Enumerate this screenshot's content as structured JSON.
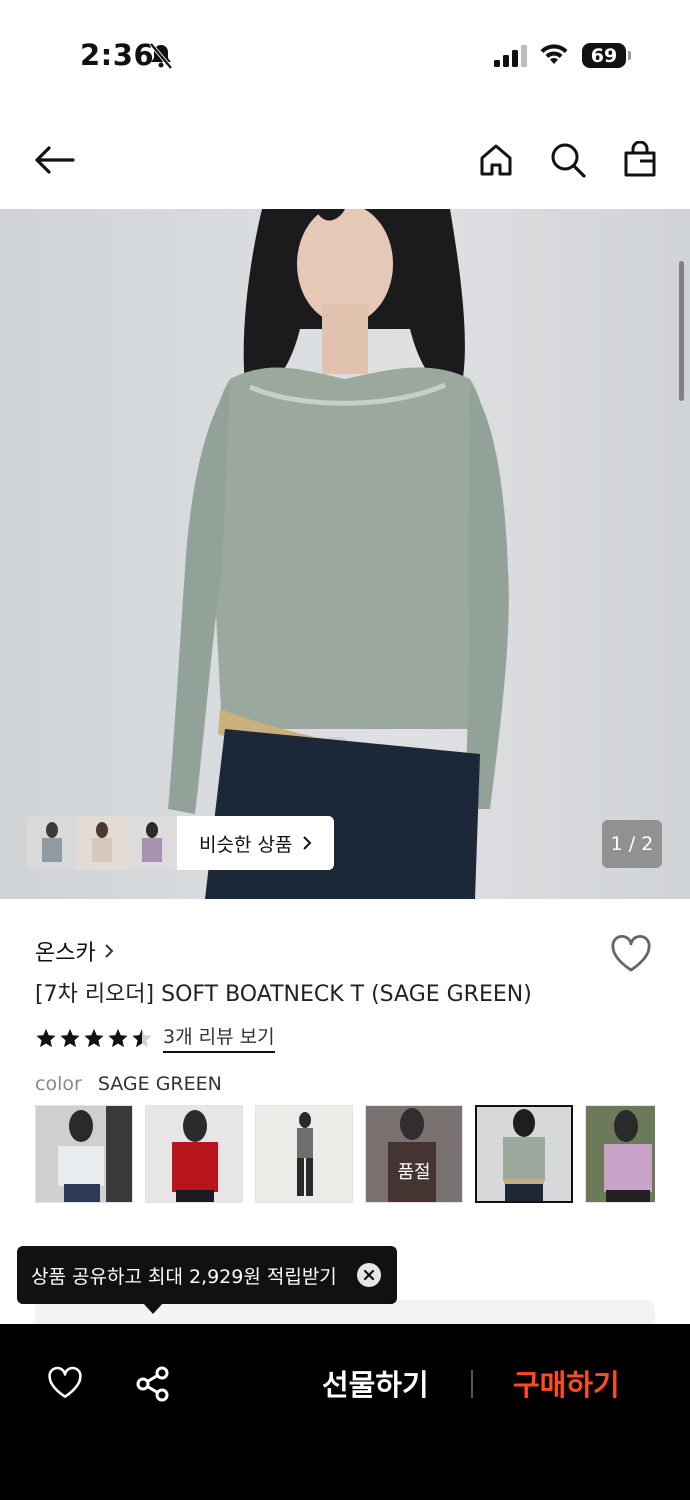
{
  "status_bar": {
    "time": "2:36",
    "battery": "69"
  },
  "nav": {
    "icons": [
      "back-arrow-icon",
      "home-icon",
      "search-icon",
      "shopping-bag-icon"
    ]
  },
  "hero": {
    "similar_label": "비슷한 상품",
    "page_indicator": "1 / 2"
  },
  "product": {
    "brand": "온스카",
    "title": "[7차 리오더] SOFT BOATNECK T (SAGE GREEN)",
    "rating_stars": 4.5,
    "review_link": "3개 리뷰 보기",
    "color_key": "color",
    "color_value": "SAGE GREEN",
    "soldout_label": "품절"
  },
  "tooltip": {
    "text": "상품 공유하고 최대 2,929원 적립받기"
  },
  "bottom_bar": {
    "gift_label": "선물하기",
    "buy_label": "구매하기"
  },
  "colors": {
    "accent": "#ff4b1f",
    "bar": "#000000",
    "sweater": "#9aa89e",
    "pants": "#1c2738"
  }
}
